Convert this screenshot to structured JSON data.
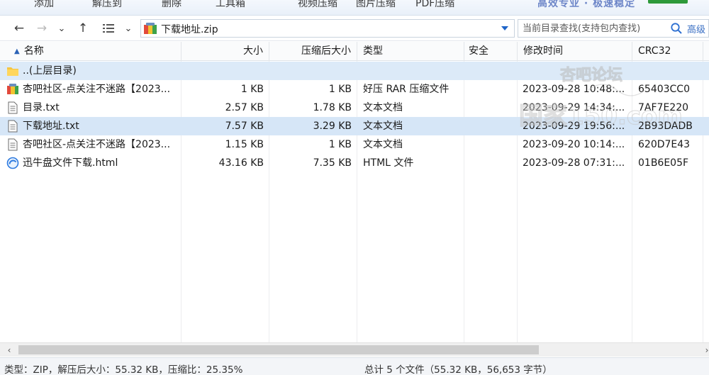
{
  "toolbar": {
    "items": [
      {
        "label": "添加"
      },
      {
        "label": "解压到"
      },
      {
        "label": "删除"
      },
      {
        "label": "工具箱"
      },
      {
        "label": "视频压缩"
      },
      {
        "label": "图片压缩"
      },
      {
        "label": "PDF压缩"
      }
    ],
    "promo_text": "高效专业 · 极速稳定"
  },
  "nav": {
    "path": "下载地址.zip",
    "search_placeholder": "当前目录查找(支持包内查找)",
    "advanced_search": "高级"
  },
  "columns": [
    {
      "label": "名称"
    },
    {
      "label": "大小"
    },
    {
      "label": "压缩后大小"
    },
    {
      "label": "类型"
    },
    {
      "label": "安全"
    },
    {
      "label": "修改时间"
    },
    {
      "label": "CRC32"
    }
  ],
  "files": [
    {
      "name": "..(上层目录)",
      "size": "",
      "packed": "",
      "type": "",
      "security": "",
      "modified": "",
      "crc": "",
      "icon": "folder-icon"
    },
    {
      "name": "杏吧社区-点关注不迷路【2023...",
      "size": "1 KB",
      "packed": "1 KB",
      "type": "好压 RAR 压缩文件",
      "security": "",
      "modified": "2023-09-28 10:48:...",
      "crc": "65403CC0",
      "icon": "rar-archive-icon"
    },
    {
      "name": "目录.txt",
      "size": "2.57 KB",
      "packed": "1.78 KB",
      "type": "文本文档",
      "security": "",
      "modified": "2023-09-29 14:34:...",
      "crc": "7AF7E220",
      "icon": "text-file-icon"
    },
    {
      "name": "下载地址.txt",
      "size": "7.57 KB",
      "packed": "3.29 KB",
      "type": "文本文档",
      "security": "",
      "modified": "2023-09-29 19:56:...",
      "crc": "2B93DADB",
      "icon": "text-file-icon"
    },
    {
      "name": "杏吧社区-点关注不迷路【2023...",
      "size": "1.15 KB",
      "packed": "1 KB",
      "type": "文本文档",
      "security": "",
      "modified": "2023-09-20 10:14:...",
      "crc": "620D7E43",
      "icon": "text-file-icon"
    },
    {
      "name": "迅牛盘文件下载.html",
      "size": "43.16 KB",
      "packed": "7.35 KB",
      "type": "HTML 文件",
      "security": "",
      "modified": "2023-09-28 07:31:...",
      "crc": "01B6E05F",
      "icon": "html-file-icon"
    }
  ],
  "status": {
    "left": "类型：ZIP，解压后大小：55.32 KB，压缩比：25.35%",
    "right": "总计 5 个文件（55.32 KB，56,653 字节）"
  },
  "watermark": {
    "line1": "杏吧论坛",
    "line2": "国家150.com"
  },
  "colors": {
    "selection": "#d6e6f7",
    "accent": "#1e64c8"
  }
}
